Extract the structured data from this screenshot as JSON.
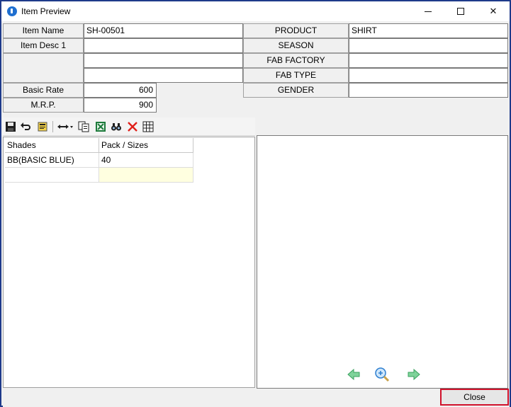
{
  "window": {
    "title": "Item Preview",
    "controls": {
      "minimize": "",
      "maximize": "",
      "close": "✕"
    }
  },
  "form": {
    "item_name_label": "Item Name",
    "item_name_value": "SH-00501",
    "item_desc_label": "Item Desc 1",
    "item_desc_values": [
      "",
      "",
      ""
    ],
    "basic_rate_label": "Basic Rate",
    "basic_rate_value": "600",
    "mrp_label": "M.R.P.",
    "mrp_value": "900",
    "product_label": "PRODUCT",
    "product_value": "SHIRT",
    "season_label": "SEASON",
    "season_value": "",
    "fab_factory_label": "FAB FACTORY",
    "fab_factory_value": "",
    "fab_type_label": "FAB TYPE",
    "fab_type_value": "",
    "gender_label": "GENDER",
    "gender_value": ""
  },
  "toolbar": {
    "icons": [
      "save-icon",
      "undo-icon",
      "export-icon",
      "column-width-icon",
      "copy-icon",
      "excel-icon",
      "find-icon",
      "delete-icon",
      "grid-icon"
    ]
  },
  "grid": {
    "columns": [
      "Shades",
      "Pack / Sizes"
    ],
    "rows": [
      {
        "shade": "BB(BASIC BLUE)",
        "pack": "40"
      }
    ]
  },
  "preview": {
    "icons": [
      "arrow-left-icon",
      "zoom-icon",
      "arrow-right-icon"
    ]
  },
  "footer": {
    "close_label": "Close"
  },
  "colors": {
    "accent_border": "#1e3a8a",
    "close_highlight": "#d0102a",
    "new_row": "#ffffe0"
  }
}
